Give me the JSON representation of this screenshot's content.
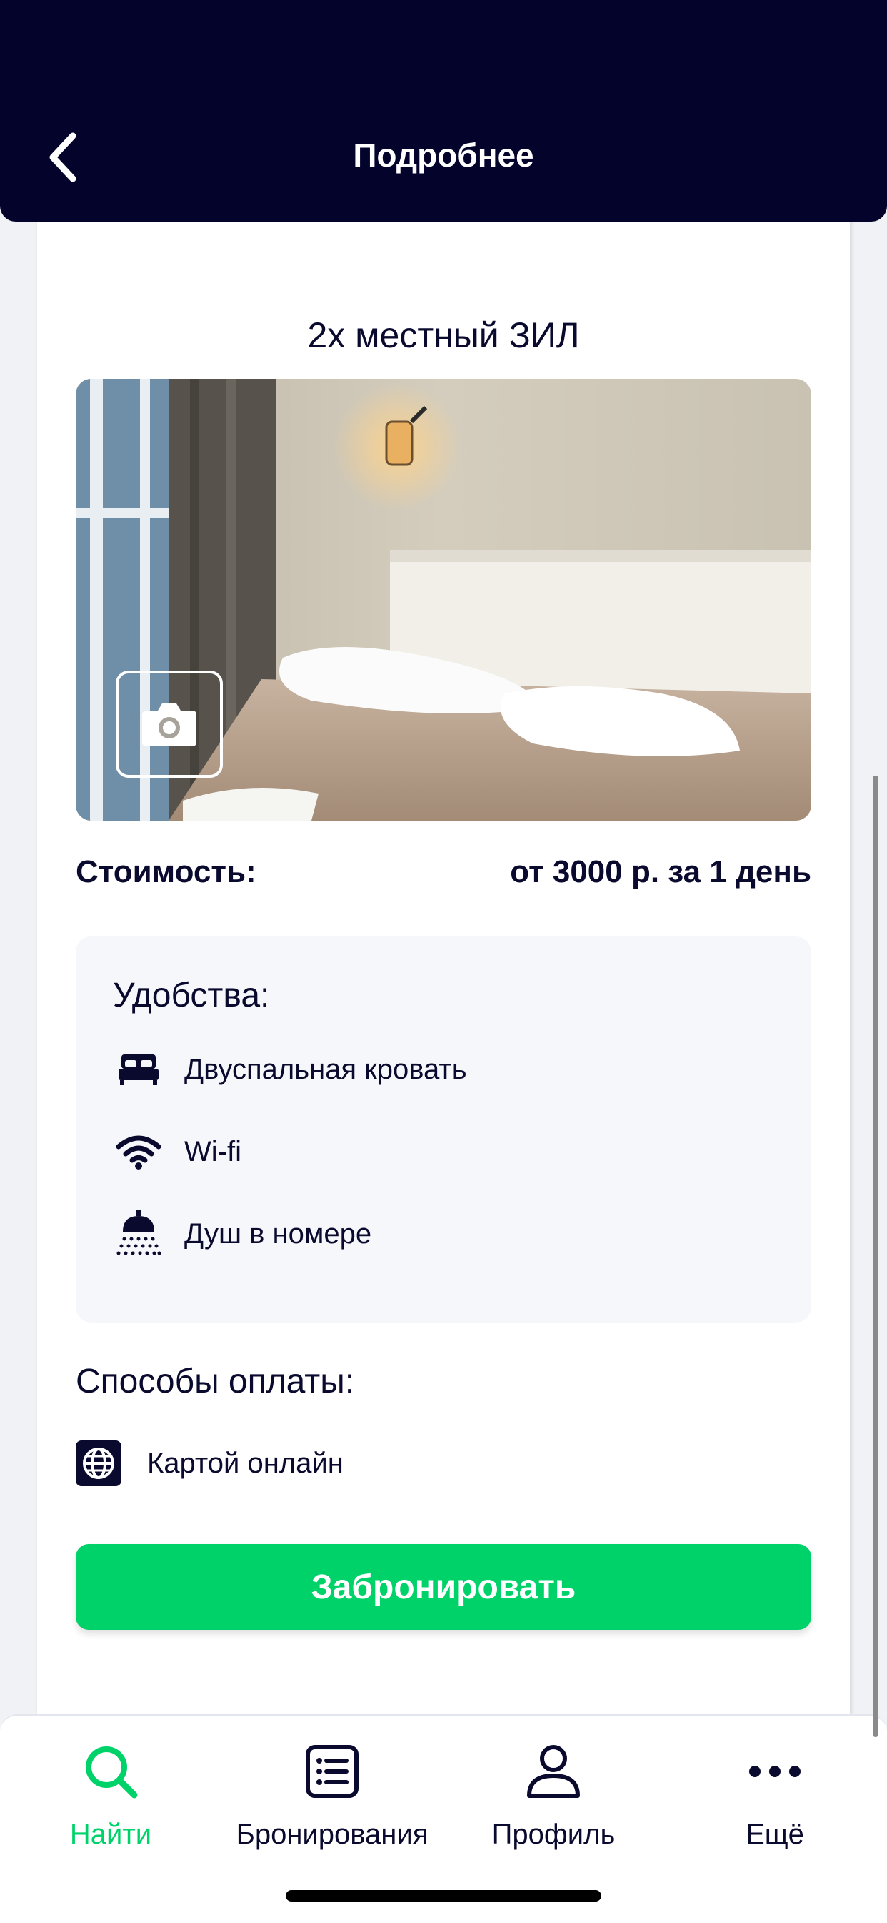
{
  "header": {
    "title": "Подробнее"
  },
  "room": {
    "title": "2х местный ЗИЛ",
    "price_label": "Стоимость:",
    "price_value": "от 3000 р. за 1 день"
  },
  "amenities": {
    "title": "Удобства:",
    "items": [
      {
        "icon": "bed-icon",
        "label": "Двуспальная кровать"
      },
      {
        "icon": "wifi-icon",
        "label": "Wi-fi"
      },
      {
        "icon": "shower-icon",
        "label": "Душ в номере"
      }
    ]
  },
  "payment": {
    "title": "Способы оплаты:",
    "items": [
      {
        "icon": "globe-icon",
        "label": "Картой онлайн"
      }
    ]
  },
  "book_button": "Забронировать",
  "tabs": [
    {
      "icon": "search-icon",
      "label": "Найти",
      "active": true
    },
    {
      "icon": "list-icon",
      "label": "Бронирования",
      "active": false
    },
    {
      "icon": "user-icon",
      "label": "Профиль",
      "active": false
    },
    {
      "icon": "more-icon",
      "label": "Ещё",
      "active": false
    }
  ],
  "colors": {
    "header_bg": "#03032b",
    "accent_green": "#00d26a",
    "text_dark": "#0a0a2e",
    "amenity_bg": "#f6f7fb"
  }
}
